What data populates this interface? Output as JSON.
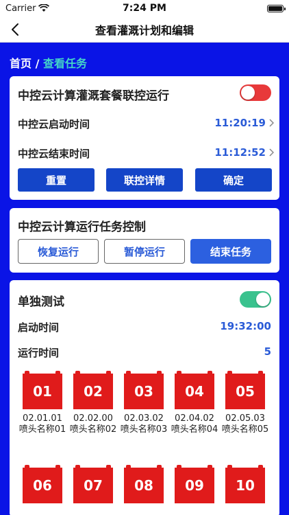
{
  "status_bar": {
    "carrier": "Carrier",
    "time": "7:24 PM"
  },
  "nav": {
    "title": "查看灌溉计划和编辑"
  },
  "breadcrumb": {
    "home": "首页",
    "separator": " / ",
    "current": "查看任务"
  },
  "card_linkage": {
    "title": "中控云计算灌溉套餐联控运行",
    "toggle_on": false,
    "start_label": "中控云启动时间",
    "start_value": "11:20:19",
    "end_label": "中控云结束时间",
    "end_value": "11:12:52",
    "buttons": {
      "reset": "重置",
      "details": "联控详情",
      "confirm": "确定"
    }
  },
  "card_control": {
    "title": "中控云计算运行任务控制",
    "buttons": {
      "resume": "恢复运行",
      "pause": "暂停运行",
      "end": "结束任务"
    }
  },
  "card_single": {
    "title": "单独测试",
    "toggle_on": true,
    "start_label": "启动时间",
    "start_value": "19:32:00",
    "run_label": "运行时间",
    "run_value": "5",
    "nozzles": [
      {
        "num": "01",
        "code": "02.01.01",
        "name": "喷头名称01"
      },
      {
        "num": "02",
        "code": "02.02.00",
        "name": "喷头名称02"
      },
      {
        "num": "03",
        "code": "02.03.02",
        "name": "喷头名称03"
      },
      {
        "num": "04",
        "code": "02.04.02",
        "name": "喷头名称04"
      },
      {
        "num": "05",
        "code": "02.05.03",
        "name": "喷头名称05"
      },
      {
        "num": "06"
      },
      {
        "num": "07"
      },
      {
        "num": "08"
      },
      {
        "num": "09"
      },
      {
        "num": "10"
      }
    ]
  },
  "colors": {
    "background": "#0a14e6",
    "accent": "#2a5bd7",
    "badge": "#e01b1b",
    "toggle_off": "#e8393a",
    "toggle_on": "#3ac28e"
  }
}
